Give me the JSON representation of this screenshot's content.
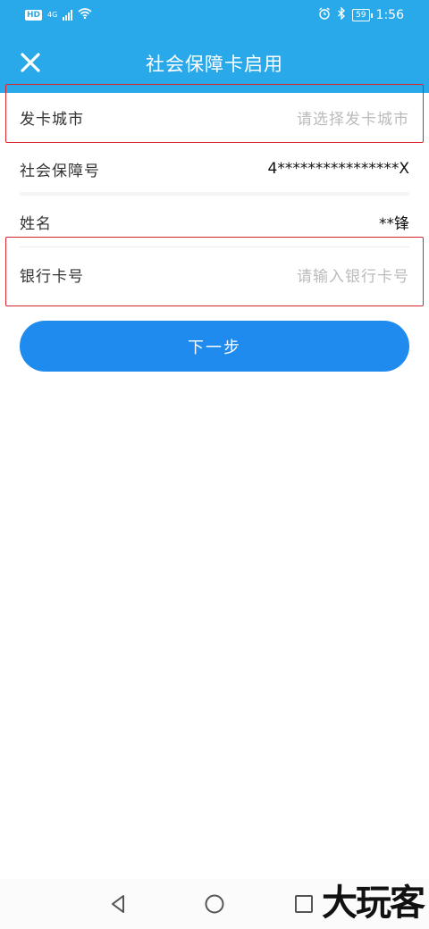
{
  "status_bar": {
    "network_badge": "HD",
    "network_type": "4G",
    "battery": "59",
    "time": "1:56"
  },
  "header": {
    "title": "社会保障卡启用"
  },
  "form": {
    "city": {
      "label": "发卡城市",
      "placeholder": "请选择发卡城市"
    },
    "ssn": {
      "label": "社会保障号",
      "value": "4****************X"
    },
    "name": {
      "label": "姓名",
      "value": "**锋"
    },
    "bank_card": {
      "label": "银行卡号",
      "placeholder": "请输入银行卡号"
    }
  },
  "actions": {
    "next_label": "下一步"
  },
  "watermark": "大玩客",
  "colors": {
    "header_bg": "#2aa9ea",
    "button_bg": "#1f8bef",
    "highlight": "#d8262c"
  }
}
